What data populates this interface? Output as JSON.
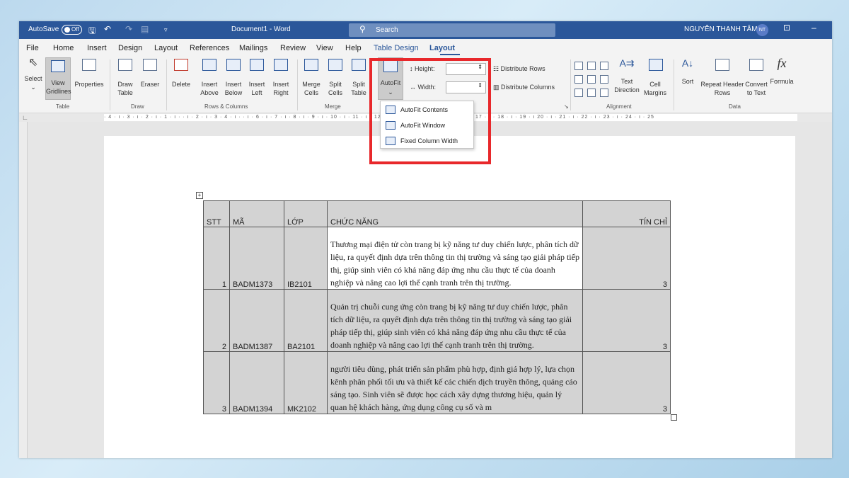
{
  "titlebar": {
    "autosave": "AutoSave",
    "toggle": "Off",
    "doc_title": "Document1 - Word",
    "search_placeholder": "Search",
    "user": "NGUYỄN THANH TÂM",
    "initials": "NT"
  },
  "menu": [
    "File",
    "Home",
    "Insert",
    "Design",
    "Layout",
    "References",
    "Mailings",
    "Review",
    "View",
    "Help",
    "Table Design",
    "Layout"
  ],
  "ribbon": {
    "select": "Select",
    "view_gridlines": "View Gridlines",
    "properties": "Properties",
    "group_table": "Table",
    "draw_table": "Draw Table",
    "eraser": "Eraser",
    "group_draw": "Draw",
    "delete": "Delete",
    "insert_above": "Insert Above",
    "insert_below": "Insert Below",
    "insert_left": "Insert Left",
    "insert_right": "Insert Right",
    "group_rows": "Rows & Columns",
    "merge_cells": "Merge Cells",
    "split_cells": "Split Cells",
    "split_table": "Split Table",
    "group_merge": "Merge",
    "autofit": "AutoFit",
    "height_label": "Height:",
    "width_label": "Width:",
    "distribute_rows": "Distribute Rows",
    "distribute_columns": "Distribute Columns",
    "text_direction": "Text Direction",
    "cell_margins": "Cell Margins",
    "group_alignment": "Alignment",
    "sort": "Sort",
    "repeat_header": "Repeat Header Rows",
    "convert_text": "Convert to Text",
    "formula": "Formula",
    "group_data": "Data"
  },
  "autofit_menu": [
    "AutoFit Contents",
    "AutoFit Window",
    "Fixed Column Width"
  ],
  "ruler_text": "· 4 · ı · 3 · ı · 2 · ı · 1 · ı ·    · ı · 2 · ı · 3    · 4 · ı ·    · ı · 6 · ı · 7 · ı · 8 · ı · 9 · ı · 10 · ı · 11 · ı · 12 · ı · 13 · ı · 14 · ı · 15 · ı ·    · ı · 17 · ı · 18 · ı · 19 · ı    20 · ı · 21 · ı · 22 · ı · 23 · ı · 24 · ı · 25",
  "table": {
    "headers": [
      "STT",
      "MÃ",
      "LỚP",
      "CHỨC NĂNG",
      "TÍN CHỈ"
    ],
    "rows": [
      {
        "stt": "1",
        "ma": "BADM1373",
        "lop": "IB2101",
        "chuc_nang": "Thương mại điện tử còn trang bị kỹ năng tư duy chiến lược, phân tích dữ liệu, ra quyết định dựa trên thông tin thị trường và sáng tạo giải pháp tiếp thị, giúp sinh viên có khả năng đáp ứng nhu cầu thực tế của doanh nghiệp và nâng cao lợi thế cạnh tranh trên thị trường.",
        "tin_chi": "3"
      },
      {
        "stt": "2",
        "ma": "BADM1387",
        "lop": "BA2101",
        "chuc_nang": "Quản trị chuỗi cung ứng còn trang bị kỹ năng tư duy chiến lược, phân tích dữ liệu, ra quyết định dựa trên thông tin thị trường và sáng tạo giải pháp tiếp thị, giúp sinh viên có khả năng đáp ứng nhu cầu thực tế của doanh nghiệp và nâng cao lợi thế cạnh tranh trên thị trường.",
        "tin_chi": "3"
      },
      {
        "stt": "3",
        "ma": "BADM1394",
        "lop": "MK2102",
        "chuc_nang": "người tiêu dùng, phát triển sản phẩm phù hợp, định giá hợp lý, lựa chọn kênh phân phối tối ưu và thiết kế các chiến dịch truyền thông, quảng cáo sáng tạo. Sinh viên sẽ được học cách xây dựng thương hiệu, quản lý quan hệ khách hàng, ứng dụng công cụ số và m",
        "tin_chi": "3"
      }
    ]
  },
  "colors": {
    "accent": "#2b579a",
    "highlight": "#e8282b"
  }
}
